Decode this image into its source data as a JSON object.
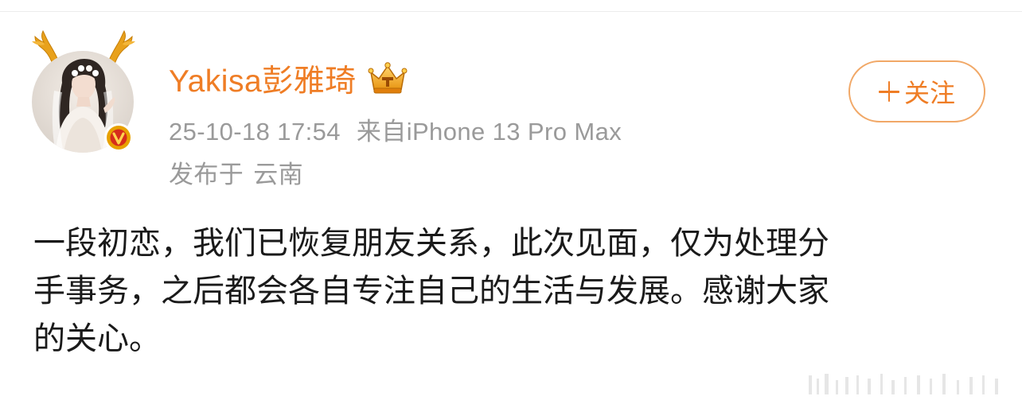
{
  "post": {
    "username": "Yakisa彭雅琦",
    "timestamp": "25-10-18 17:54",
    "source": "来自iPhone 13 Pro Max",
    "location_prefix": "发布于",
    "location": "云南",
    "body_lines": [
      "一段初恋，我们已恢复朋友关系，此次见面，仅为处理分",
      "手事务，之后都会各自专注自己的生活与发展。感谢大家",
      "的关心。"
    ]
  },
  "follow_button": {
    "label": "关注"
  },
  "icons": {
    "avatar": "avatar-image",
    "antlers": "antler-decoration-icon",
    "verified": "verified-v-badge-icon",
    "crown": "vip-crown-icon",
    "plus": "plus-icon"
  },
  "colors": {
    "username": "#ef7d25",
    "meta": "#9a9a9a",
    "body": "#1a1a1a",
    "follow_border": "#f1a867",
    "verified_badge": "#e8a100"
  }
}
